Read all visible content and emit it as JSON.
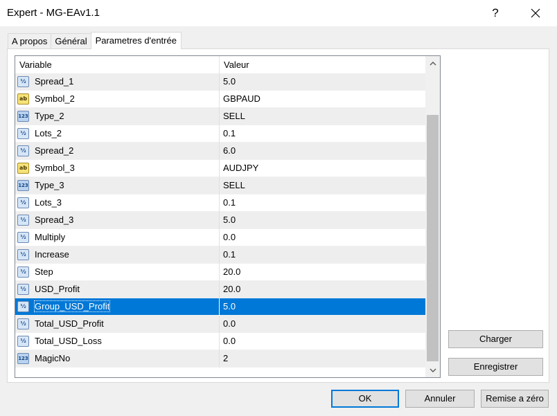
{
  "window": {
    "title": "Expert - MG-EAv1.1",
    "help_label": "?"
  },
  "tabs": [
    {
      "label": "A propos",
      "active": false
    },
    {
      "label": "Général",
      "active": false
    },
    {
      "label": "Parametres d'entrée",
      "active": true
    }
  ],
  "table": {
    "columns": [
      "Variable",
      "Valeur"
    ],
    "rows": [
      {
        "icon": "double-icon",
        "name": "Spread_1",
        "value": "5.0"
      },
      {
        "icon": "string-icon",
        "name": "Symbol_2",
        "value": "GBPAUD"
      },
      {
        "icon": "integer-icon",
        "name": "Type_2",
        "value": "SELL"
      },
      {
        "icon": "double-icon",
        "name": "Lots_2",
        "value": "0.1"
      },
      {
        "icon": "double-icon",
        "name": "Spread_2",
        "value": "6.0"
      },
      {
        "icon": "string-icon",
        "name": "Symbol_3",
        "value": "AUDJPY"
      },
      {
        "icon": "integer-icon",
        "name": "Type_3",
        "value": "SELL"
      },
      {
        "icon": "double-icon",
        "name": "Lots_3",
        "value": "0.1"
      },
      {
        "icon": "double-icon",
        "name": "Spread_3",
        "value": "5.0"
      },
      {
        "icon": "double-icon",
        "name": "Multiply",
        "value": "0.0"
      },
      {
        "icon": "double-icon",
        "name": "Increase",
        "value": "0.1"
      },
      {
        "icon": "double-icon",
        "name": "Step",
        "value": "20.0"
      },
      {
        "icon": "double-icon",
        "name": "USD_Profit",
        "value": "20.0"
      },
      {
        "icon": "double-icon",
        "name": "Group_USD_Profit",
        "value": "5.0",
        "selected": true
      },
      {
        "icon": "double-icon",
        "name": "Total_USD_Profit",
        "value": "0.0"
      },
      {
        "icon": "double-icon",
        "name": "Total_USD_Loss",
        "value": "0.0"
      },
      {
        "icon": "integer-icon",
        "name": "MagicNo",
        "value": "2"
      }
    ]
  },
  "icon_glyphs": {
    "double-icon": "½",
    "string-icon": "ab",
    "integer-icon": "123"
  },
  "buttons": {
    "load": "Charger",
    "save": "Enregistrer",
    "ok": "OK",
    "cancel": "Annuler",
    "reset": "Remise a zéro"
  },
  "colors": {
    "selection": "#0078d7"
  }
}
